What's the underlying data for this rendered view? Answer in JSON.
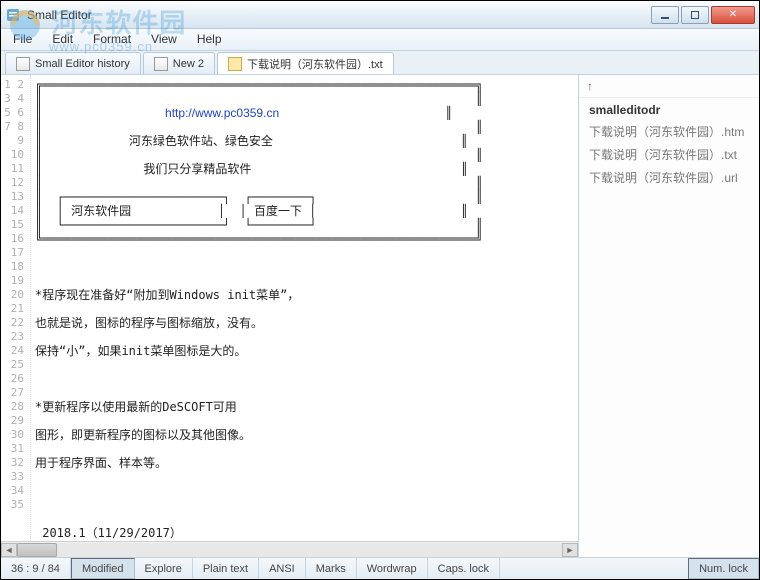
{
  "window": {
    "title": "Small Editor"
  },
  "watermark": {
    "text": "河东软件园",
    "url": "www.pc0359.cn"
  },
  "menu": {
    "items": [
      "File",
      "Edit",
      "Format",
      "View",
      "Help"
    ]
  },
  "tabs": {
    "items": [
      {
        "label": "Small Editor history",
        "active": false
      },
      {
        "label": "New 2",
        "active": false
      },
      {
        "label": "下载说明（河东软件园）.txt",
        "active": true
      }
    ]
  },
  "editor": {
    "line_start": 1,
    "line_end": 35,
    "lines": [
      "╔════════════════════════════════════════════════════════════╗",
      "║                                                            ║",
      "║                 http://www.pc0359.cn                       ║",
      "║                                                            ║",
      "║            河东绿色软件站、绿色安全                          ║",
      "║                                                            ║",
      "║              我们只分享精品软件                             ║",
      "║                                                            ║",
      "║  ┌──────────────────────┐  ┌────────┐                      ║",
      "║  │ 河东软件园            │  │ 百度一下 │                    ║",
      "║  └──────────────────────┘  └────────┘                      ║",
      "╚════════════════════════════════════════════════════════════╝",
      "",
      "",
      "",
      "*程序现在准备好“附加到Windows init菜单”，",
      "",
      "也就是说，图标的程序与图标缩放，没有。",
      "",
      "保持“小”，如果init菜单图标是大的。",
      "",
      "",
      "",
      "*更新程序以使用最新的DeSCOFT可用",
      "",
      "图形，即更新程序的图标以及其他图像。",
      "",
      "用于程序界面、样本等。",
      "",
      "",
      "",
      "",
      " 2018.1（11/29/2017）",
      "",
      ""
    ]
  },
  "side": {
    "up_arrow": "↑",
    "items": [
      {
        "label": "smalleditodr",
        "bold": true
      },
      {
        "label": "下载说明（河东软件园）.htm",
        "bold": false
      },
      {
        "label": "下载说明（河东软件园）.txt",
        "bold": false
      },
      {
        "label": "下载说明（河东软件园）.url",
        "bold": false
      }
    ]
  },
  "status": {
    "position": "36 : 9 / 84",
    "modified": "Modified",
    "explore": "Explore",
    "syntax": "Plain text",
    "encoding": "ANSI",
    "marks": "Marks",
    "wordwrap": "Wordwrap",
    "capslock": "Caps. lock",
    "numlock": "Num. lock"
  },
  "colors": {
    "titlebar_bg": "#e9f1f7",
    "accent": "#2f6aa0",
    "close_btn": "#d94f3d",
    "link": "#2040d0"
  }
}
